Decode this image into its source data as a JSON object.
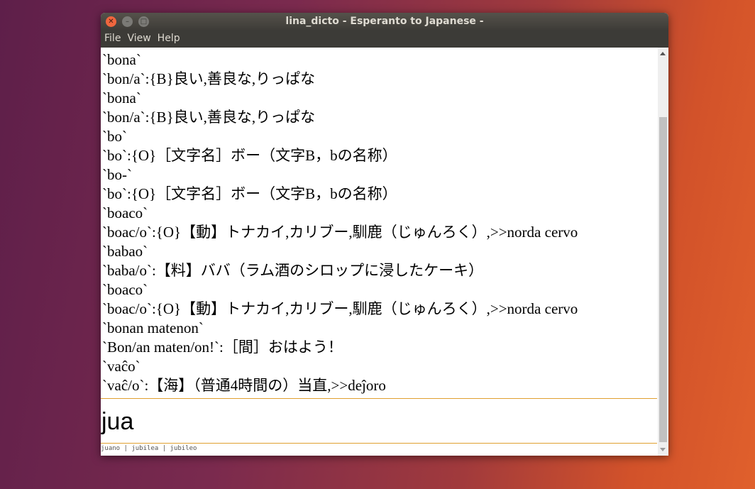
{
  "window": {
    "title": "lina_dicto - Esperanto to Japanese -"
  },
  "menu": [
    "File",
    "View",
    "Help"
  ],
  "lines": [
    "`bona`",
    "`bon/a`:{B}良い,善良な,りっぱな",
    "`bona`",
    "`bon/a`:{B}良い,善良な,りっぱな",
    "`bo`",
    "`bo`:{O}［文字名］ボー（文字B，bの名称）",
    "`bo-`",
    "`bo`:{O}［文字名］ボー（文字B，bの名称）",
    "`boaco`",
    "`boac/o`:{O}【動】トナカイ,カリブー,馴鹿（じゅんろく）,>>norda cervo",
    "`babao`",
    "`baba/o`:【料】ババ（ラム酒のシロップに浸したケーキ）",
    "`boaco`",
    "`boac/o`:{O}【動】トナカイ,カリブー,馴鹿（じゅんろく）,>>norda cervo",
    "`bonan matenon`",
    "`Bon/an maten/on!`:［間］おはよう！",
    "`vaĉo`",
    "`vaĉ/o`:【海】（普通4時間の）当直,>>deĵoro"
  ],
  "input": {
    "value": "jua"
  },
  "suggestions": "juano | jubilea | jubileo",
  "scrollbar": {
    "position_percent": 85
  }
}
